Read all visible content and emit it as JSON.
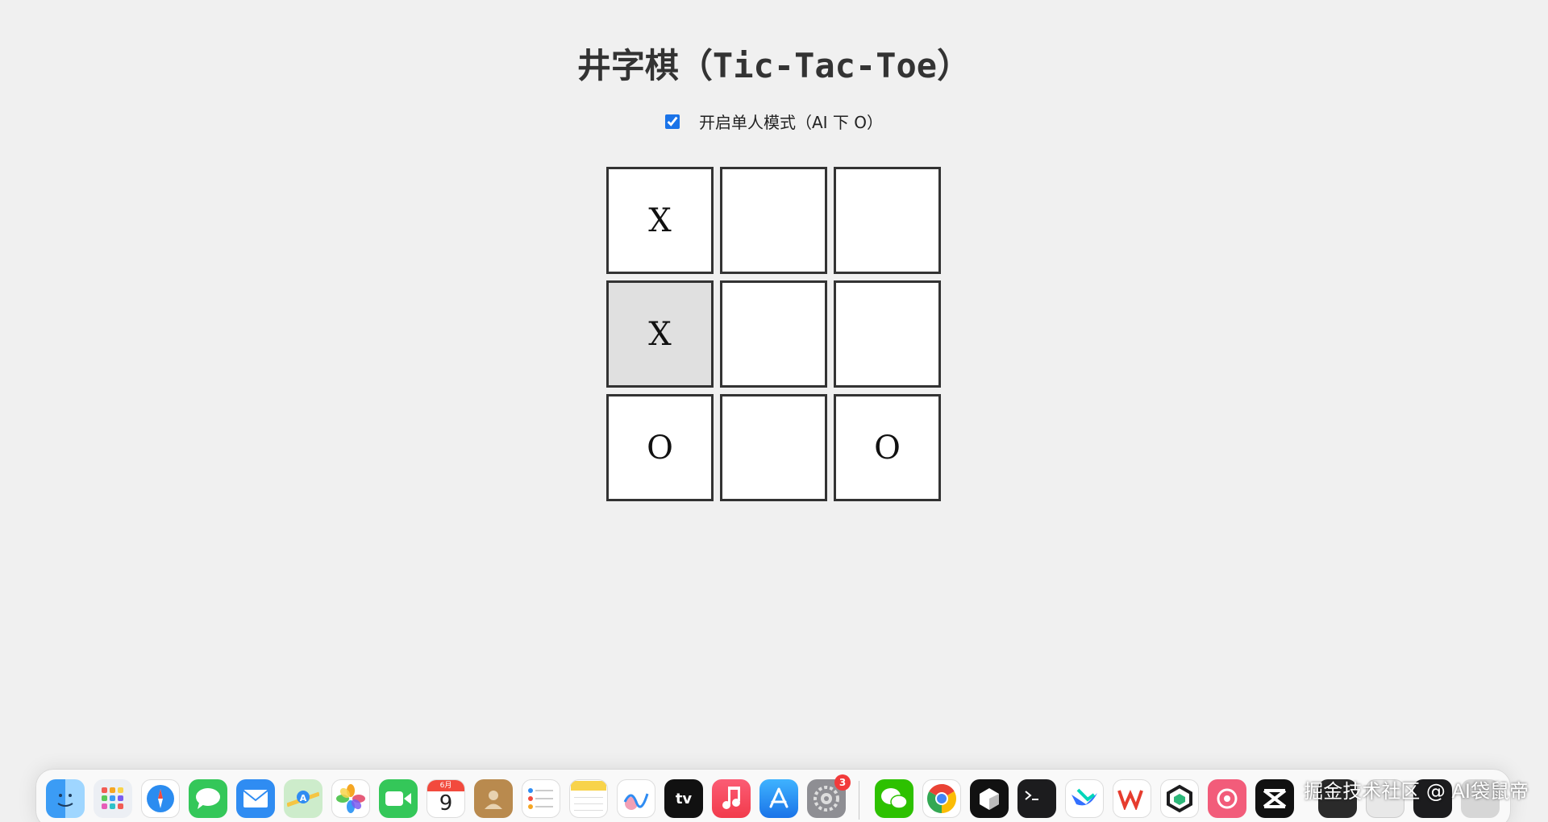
{
  "title": "井字棋（Tic-Tac-Toe）",
  "mode": {
    "label": "开启单人模式（AI 下 O）",
    "checked": true
  },
  "board": {
    "cells": [
      "X",
      "",
      "",
      "X",
      "",
      "",
      "O",
      "",
      "O"
    ],
    "highlighted_cell_index": 3
  },
  "dock": {
    "calendar_month": "6月",
    "calendar_day": "9",
    "settings_badge": "3",
    "icons": [
      "finder-icon",
      "launchpad-icon",
      "safari-icon",
      "messages-icon",
      "mail-icon",
      "maps-icon",
      "photos-icon",
      "facetime-icon",
      "calendar-icon",
      "contacts-icon",
      "reminders-icon",
      "notes-icon",
      "freeform-icon",
      "apple-tv-icon",
      "music-icon",
      "app-store-icon",
      "system-settings-icon",
      "wechat-icon",
      "chrome-icon",
      "cube-app-icon",
      "terminal-icon",
      "feishu-icon",
      "wps-icon",
      "box-app-icon",
      "app-icon",
      "capcut-icon"
    ],
    "tv_label": "tv"
  },
  "watermark": "掘金技术社区 @ AI袋鼠帝",
  "colors": {
    "background": "#f0f0f0",
    "cell_border": "#333333",
    "cell_highlight": "#e0e0e0",
    "checkbox_accent": "#1a73e8"
  }
}
